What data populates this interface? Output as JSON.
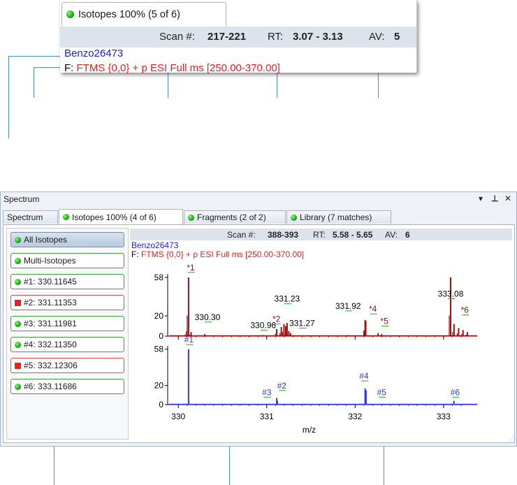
{
  "zoom": {
    "tab_label": "Isotopes 100% (5 of 6)",
    "scan_label": "Scan #:",
    "scan_value": "217-221",
    "rt_label": "RT:",
    "rt_value": "3.07 - 3.13",
    "av_label": "AV:",
    "av_value": "5",
    "compound": "Benzo26473",
    "filter_prefix": "F:",
    "filter_value": "FTMS {0,0}  + p ESI Full ms [250.00-370.00]"
  },
  "window": {
    "title": "Spectrum",
    "controls": [
      "▾",
      "ᵖ",
      "✕"
    ],
    "tabs": [
      {
        "label": "Spectrum"
      },
      {
        "label": "Isotopes 100% (4 of 6)"
      },
      {
        "label": "Fragments (2 of 2)"
      },
      {
        "label": "Library (7 matches)"
      }
    ]
  },
  "isotopes": [
    {
      "label": "All Isotopes",
      "status": "ok"
    },
    {
      "label": "Multi-Isotopes",
      "status": "ok"
    },
    {
      "label": "#1: 330.11645",
      "status": "ok"
    },
    {
      "label": "#2: 331.11353",
      "status": "fail"
    },
    {
      "label": "#3: 331.11981",
      "status": "ok"
    },
    {
      "label": "#4: 332.11350",
      "status": "ok"
    },
    {
      "label": "#5: 332.12306",
      "status": "fail"
    },
    {
      "label": "#6: 333.11686",
      "status": "ok"
    }
  ],
  "scan": {
    "scan_label": "Scan #:",
    "scan_value": "388-393",
    "rt_label": "RT:",
    "rt_value": "5.58 - 5.65",
    "av_label": "AV:",
    "av_value": "6",
    "compound": "Benzo26473",
    "filter_prefix": "F:",
    "filter_value": "FTMS {0,0}  + p ESI Full ms [250.00-370.00]"
  },
  "colors": {
    "measured": "#9b0f12",
    "theoretical": "#3434ee",
    "label_line": "#22aa22",
    "ok": "#1aa51a",
    "fail": "#e8201e",
    "callout": "#4a90c8"
  },
  "chart_data": {
    "type": "line",
    "xlabel": "m/z",
    "xlim": [
      329.88,
      333.38
    ],
    "x_ticks": [
      330,
      331,
      332,
      333
    ],
    "top": {
      "ylim": [
        0,
        60
      ],
      "y_ticks": [
        0,
        20,
        58
      ],
      "peaks": [
        {
          "x": 330.116,
          "y": 58
        },
        {
          "x": 330.095,
          "y": 5
        },
        {
          "x": 330.145,
          "y": 4
        },
        {
          "x": 330.3,
          "y": 2
        },
        {
          "x": 330.96,
          "y": 1
        },
        {
          "x": 331.113,
          "y": 7
        },
        {
          "x": 331.165,
          "y": 9
        },
        {
          "x": 331.195,
          "y": 12
        },
        {
          "x": 331.215,
          "y": 10
        },
        {
          "x": 331.23,
          "y": 13
        },
        {
          "x": 331.25,
          "y": 5
        },
        {
          "x": 331.27,
          "y": 3
        },
        {
          "x": 331.92,
          "y": 1
        },
        {
          "x": 332.113,
          "y": 16
        },
        {
          "x": 332.12,
          "y": 15
        },
        {
          "x": 332.26,
          "y": 3
        },
        {
          "x": 332.3,
          "y": 2
        },
        {
          "x": 333.08,
          "y": 58
        },
        {
          "x": 333.118,
          "y": 12
        },
        {
          "x": 333.17,
          "y": 8
        },
        {
          "x": 333.22,
          "y": 6
        },
        {
          "x": 333.27,
          "y": 4
        }
      ],
      "labels": [
        {
          "text": "*1",
          "x": 330.14,
          "y": 65,
          "kind": "star"
        },
        {
          "text": "330.30",
          "x": 330.33,
          "y": 16,
          "kind": "mass"
        },
        {
          "text": "330.96",
          "x": 330.96,
          "y": 8,
          "kind": "mass"
        },
        {
          "text": "*2",
          "x": 331.11,
          "y": 14,
          "kind": "star"
        },
        {
          "text": "331.23",
          "x": 331.23,
          "y": 34,
          "kind": "mass"
        },
        {
          "text": "331.27",
          "x": 331.4,
          "y": 10,
          "kind": "mass"
        },
        {
          "text": "331.92",
          "x": 331.92,
          "y": 27,
          "kind": "mass"
        },
        {
          "text": "*4",
          "x": 332.2,
          "y": 24,
          "kind": "star"
        },
        {
          "text": "*5",
          "x": 332.33,
          "y": 12,
          "kind": "star"
        },
        {
          "text": "333.08",
          "x": 333.08,
          "y": 39,
          "kind": "mass"
        },
        {
          "text": "*6",
          "x": 333.24,
          "y": 23,
          "kind": "star"
        }
      ]
    },
    "bottom": {
      "ylim": [
        0,
        60
      ],
      "y_ticks": [
        0,
        20,
        58
      ],
      "peaks": [
        {
          "x": 330.116,
          "y": 58
        },
        {
          "x": 331.12,
          "y": 4
        },
        {
          "x": 331.113,
          "y": 7
        },
        {
          "x": 332.113,
          "y": 17
        },
        {
          "x": 332.123,
          "y": 15
        },
        {
          "x": 333.117,
          "y": 4
        }
      ],
      "labels": [
        {
          "text": "#1",
          "x": 330.12,
          "y": 65
        },
        {
          "text": "#3",
          "x": 331.0,
          "y": 10
        },
        {
          "text": "#2",
          "x": 331.17,
          "y": 17
        },
        {
          "text": "#4",
          "x": 332.1,
          "y": 27
        },
        {
          "text": "#5",
          "x": 332.3,
          "y": 10
        },
        {
          "text": "#6",
          "x": 333.13,
          "y": 10
        }
      ]
    }
  }
}
